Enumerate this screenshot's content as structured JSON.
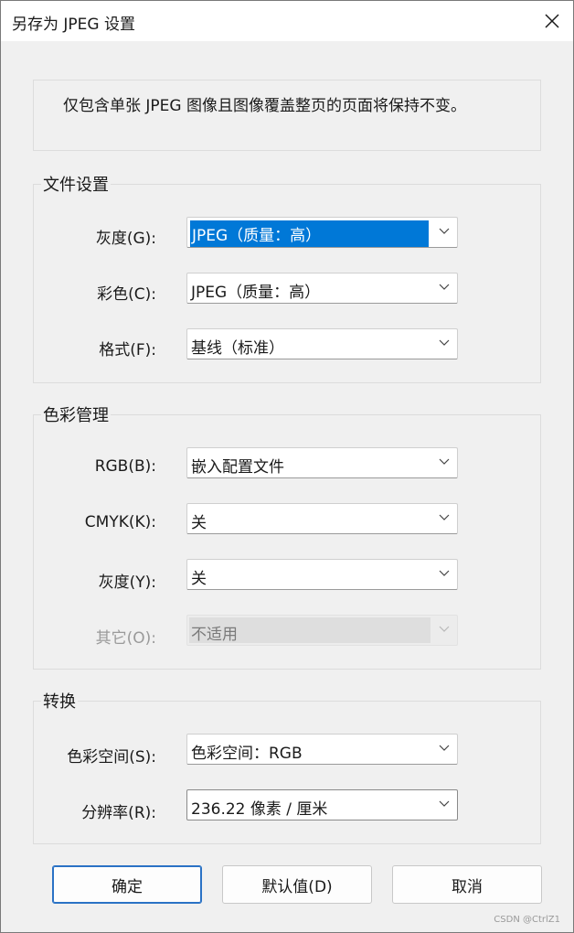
{
  "window": {
    "title": "另存为 JPEG 设置"
  },
  "notice": "仅包含单张 JPEG 图像且图像覆盖整页的页面将保持不变。",
  "file_settings": {
    "title": "文件设置",
    "gray_label": "灰度(G):",
    "gray_value": "JPEG（质量：高）",
    "color_label": "彩色(C):",
    "color_value": "JPEG（质量：高）",
    "format_label": "格式(F):",
    "format_value": "基线（标准）"
  },
  "color_management": {
    "title": "色彩管理",
    "rgb_label": "RGB(B):",
    "rgb_value": "嵌入配置文件",
    "cmyk_label": "CMYK(K):",
    "cmyk_value": "关",
    "gray_label": "灰度(Y):",
    "gray_value": "关",
    "other_label": "其它(O):",
    "other_value": "不适用"
  },
  "conversion": {
    "title": "转换",
    "colorspace_label": "色彩空间(S):",
    "colorspace_value": "色彩空间：RGB",
    "resolution_label": "分辨率(R):",
    "resolution_value": "236.22 像素 / 厘米"
  },
  "buttons": {
    "ok": "确定",
    "default": "默认值(D)",
    "cancel": "取消"
  },
  "watermark": "CSDN @CtrlZ1",
  "colors": {
    "accent": "#0078d7",
    "bg": "#f0f0f0"
  }
}
